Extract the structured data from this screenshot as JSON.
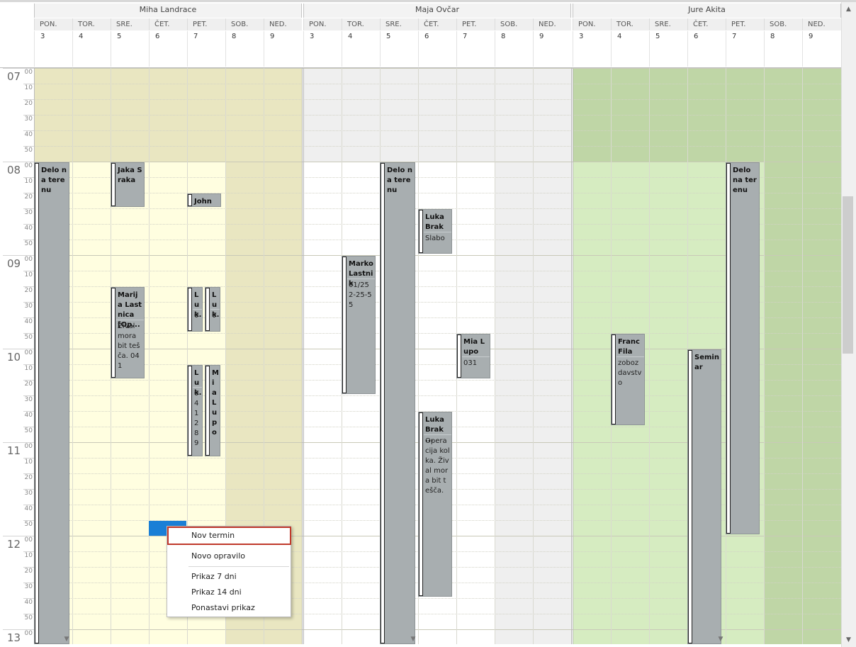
{
  "resources": [
    "Miha Landrace",
    "Maja Ovčar",
    "Jure Akita"
  ],
  "day_names": [
    "PON.",
    "TOR.",
    "SRE.",
    "ČET.",
    "PET.",
    "SOB.",
    "NED."
  ],
  "day_numbers": [
    "3",
    "4",
    "5",
    "6",
    "7",
    "8",
    "9"
  ],
  "hours": [
    "07",
    "08",
    "09",
    "10",
    "11",
    "12",
    "13"
  ],
  "minutes": [
    "00",
    "10",
    "20",
    "30",
    "40",
    "50"
  ],
  "colors": {
    "r1_work": "#fffee0",
    "r1_off": "#e9e6c1",
    "r2_work": "#ffffff",
    "r2_off": "#efefef",
    "r3_work": "#d6ecc1",
    "r3_off": "#bfd6a6",
    "selection": "#1a7fd6",
    "menu_highlight": "#c0392b"
  },
  "appointments": [
    {
      "title": "Delo na terenu",
      "details": ""
    },
    {
      "title": "Jaka Sraka",
      "details": ""
    },
    {
      "title": "John ...",
      "details": ""
    },
    {
      "title": "Marija Lastnica [Op...",
      "details": "Žival mora bit tešča. 041"
    },
    {
      "title": "Luk...",
      "details": "0"
    },
    {
      "title": "Luk...",
      "details": "0"
    },
    {
      "title": "Luk...",
      "details": "041289"
    },
    {
      "title": "Mia Lupo",
      "details": ""
    },
    {
      "title": "Marko Lastnik",
      "details": "01/252-25-55"
    },
    {
      "title": "Delo na terenu",
      "details": ""
    },
    {
      "title": "Luka Brak",
      "details": "Slabo"
    },
    {
      "title": "Mia Lupo",
      "details": "031"
    },
    {
      "title": "Luka Brak ...",
      "details": "Operacija kolka. Žival mora bit tešča."
    },
    {
      "title": "Franc Fila",
      "details": "zobozdavstvo"
    },
    {
      "title": "Seminar",
      "details": ""
    },
    {
      "title": "Delo na terenu",
      "details": ""
    }
  ],
  "context_menu": {
    "items": [
      "Nov termin",
      "Novo opravilo",
      "Prikaz 7 dni",
      "Prikaz  14 dni",
      "Ponastavi prikaz"
    ]
  },
  "scrollbar": {
    "up_arrow": "▲",
    "down_arrow": "▼"
  },
  "icons": {
    "column_scroll_down": "▼"
  }
}
